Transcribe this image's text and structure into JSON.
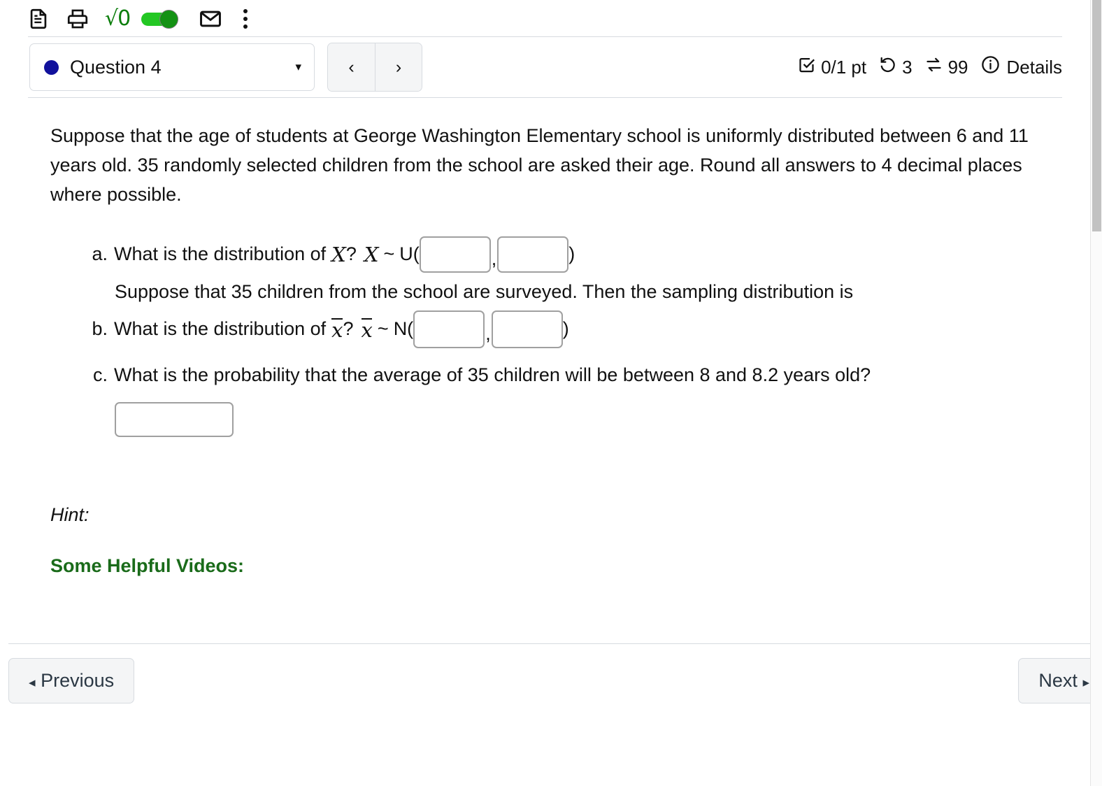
{
  "toolbar": {
    "doc_icon": "document-icon",
    "print_icon": "printer-icon",
    "math_icon_label": "√0",
    "math_toggle_state": "on",
    "mail_icon": "mail-icon",
    "more_icon": "kebab-menu-icon",
    "accent_green": "#149214",
    "track_green": "#23c723"
  },
  "question_header": {
    "selected_question": "Question 4",
    "dot_color": "#11119c",
    "caret": "▾",
    "prev_symbol": "‹",
    "next_symbol": "›",
    "status": {
      "score": "0/1 pt",
      "attempts": "3",
      "versions": "99",
      "details_label": "Details",
      "score_icon": "checkbox-checked-icon",
      "attempts_icon": "undo-arrow-icon",
      "versions_icon": "swap-arrows-icon",
      "details_icon": "info-circle-icon"
    }
  },
  "question": {
    "prompt": "Suppose that the age of students at George Washington Elementary school is uniformly distributed between 6 and 11 years old. 35 randomly selected children from the school are asked their age. Round all answers to 4 decimal places where possible.",
    "parts": {
      "a": {
        "letter": "a.",
        "text": "What is the distribution of",
        "var1": "X",
        "q": "?",
        "var2": "X",
        "tilde": "~",
        "dist": "U(",
        "comma": ",",
        "close": ")",
        "value1": "",
        "value2": ""
      },
      "interlude": "Suppose that 35 children from the school are surveyed. Then the sampling distribution is",
      "b": {
        "letter": "b.",
        "text": "What is the distribution of",
        "var1": "x",
        "q": "?",
        "var2": "x",
        "tilde": "~",
        "dist": "N(",
        "comma": ",",
        "close": ")",
        "value1": "",
        "value2": ""
      },
      "c": {
        "letter": "c.",
        "text": "What is the probability that the average of 35 children will be between 8 and 8.2 years old?",
        "value": ""
      }
    }
  },
  "hint": {
    "label": "Hint:",
    "videos_label": "Some Helpful Videos:",
    "videos_color": "#1a6b1a"
  },
  "footer": {
    "previous_label": "Previous",
    "next_label": "Next",
    "prev_arrow": "◂",
    "next_arrow": "▸"
  }
}
